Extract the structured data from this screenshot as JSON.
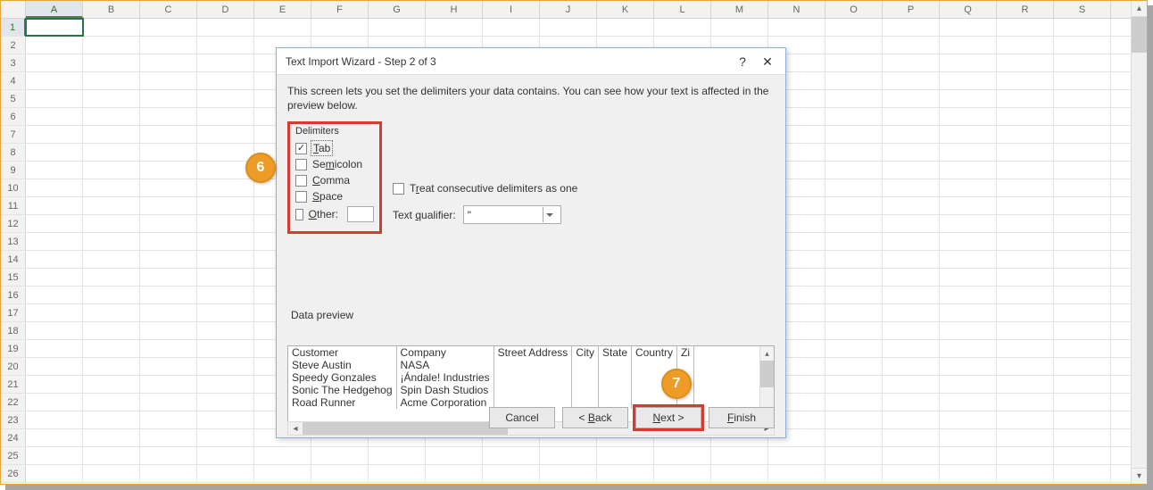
{
  "columns": [
    "A",
    "B",
    "C",
    "D",
    "E",
    "F",
    "G",
    "H",
    "I",
    "J",
    "K",
    "L",
    "M",
    "N",
    "O",
    "P",
    "Q",
    "R",
    "S"
  ],
  "rows": [
    "1",
    "2",
    "3",
    "4",
    "5",
    "6",
    "7",
    "8",
    "9",
    "10",
    "11",
    "12",
    "13",
    "14",
    "15",
    "16",
    "17",
    "18",
    "19",
    "20",
    "21",
    "22",
    "23",
    "24",
    "25",
    "26"
  ],
  "selected_cell": "A1",
  "dialog": {
    "title": "Text Import Wizard - Step 2 of 3",
    "desc": "This screen lets you set the delimiters your data contains.  You can see how your text is affected in the preview below.",
    "delimiters_label": "Delimiters",
    "tab": "Tab",
    "semicolon": "Semicolon",
    "comma": "Comma",
    "space": "Space",
    "other": "Other:",
    "tab_checked": true,
    "treat_consecutive": "Treat consecutive delimiters as one",
    "text_qualifier_label": "Text qualifier:",
    "text_qualifier_value": "\"",
    "preview_label": "Data preview",
    "preview_cols": [
      [
        "Customer",
        "Steve Austin",
        "Speedy Gonzales",
        "Sonic The Hedgehog",
        "Road Runner"
      ],
      [
        "Company",
        "NASA",
        "¡Ándale! Industries",
        "Spin Dash Studios",
        "Acme Corporation"
      ],
      [
        "Street Address",
        "",
        "",
        "",
        ""
      ],
      [
        "City",
        "",
        "",
        "",
        ""
      ],
      [
        "State",
        "",
        "",
        "",
        ""
      ],
      [
        "Country",
        "",
        "",
        "",
        ""
      ],
      [
        "Zi",
        "",
        "",
        "",
        ""
      ]
    ],
    "cancel": "Cancel",
    "back": "< Back",
    "next": "Next >",
    "finish": "Finish"
  },
  "annotations": {
    "six": "6",
    "seven": "7"
  }
}
